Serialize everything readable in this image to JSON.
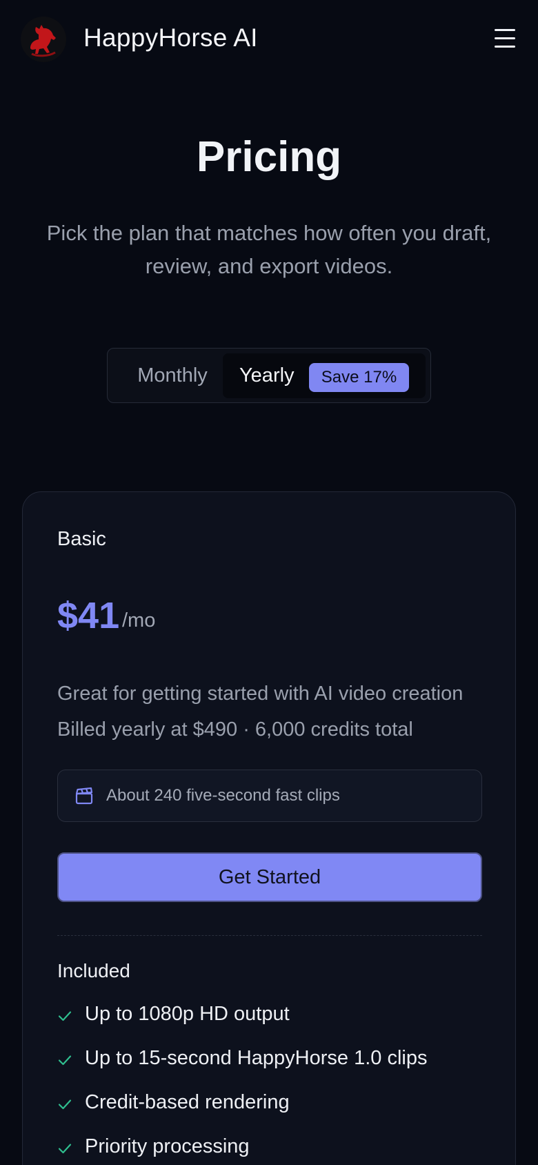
{
  "header": {
    "brand": "HappyHorse AI",
    "logo_icon": "horse-logo-icon",
    "menu_icon": "hamburger-menu-icon"
  },
  "hero": {
    "title": "Pricing",
    "subtitle": "Pick the plan that matches how often you draft, review, and export videos."
  },
  "billing_toggle": {
    "monthly_label": "Monthly",
    "yearly_label": "Yearly",
    "save_badge": "Save 17%",
    "selected": "Yearly"
  },
  "plan": {
    "name": "Basic",
    "price": "$41",
    "period": "/mo",
    "description": "Great for getting started with AI video creation",
    "billing_note": "Billed yearly at $490 · 6,000 credits total",
    "info_icon": "clapperboard-icon",
    "info_text": "About 240 five-second fast clips",
    "cta_label": "Get Started",
    "included_heading": "Included",
    "features": [
      "Up to 1080p HD output",
      "Up to 15-second HappyHorse 1.0 clips",
      "Credit-based rendering",
      "Priority processing"
    ]
  },
  "colors": {
    "background": "#070a13",
    "accent": "#8088f4",
    "check": "#2fbf8f",
    "card": "#0d111d"
  }
}
